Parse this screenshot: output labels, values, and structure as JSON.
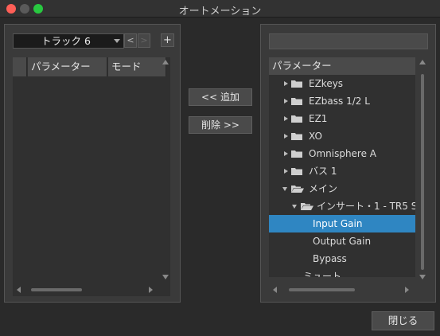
{
  "window": {
    "title": "オートメーション"
  },
  "left": {
    "track_selector": "トラック 6",
    "prev": "<",
    "next": ">",
    "add": "+",
    "columns": [
      "",
      "パラメーター",
      "モード"
    ]
  },
  "middle": {
    "add_label": "<< 追加",
    "remove_label": "削除 >>"
  },
  "right": {
    "search_value": "",
    "tree_header": "パラメーター",
    "tree": [
      {
        "label": "EZkeys",
        "expanded": false,
        "folder": true
      },
      {
        "label": "EZbass 1/2 L",
        "expanded": false,
        "folder": true
      },
      {
        "label": "EZ1",
        "expanded": false,
        "folder": true
      },
      {
        "label": "XO",
        "expanded": false,
        "folder": true
      },
      {
        "label": "Omnisphere A",
        "expanded": false,
        "folder": true
      },
      {
        "label": "バス 1",
        "expanded": false,
        "folder": true
      },
      {
        "label": "メイン",
        "expanded": true,
        "folder": true
      },
      {
        "label": "インサート・1 - TR5 S",
        "expanded": true,
        "folder": true
      },
      {
        "label": "Input Gain",
        "selected": true
      },
      {
        "label": "Output Gain"
      },
      {
        "label": "Bypass"
      },
      {
        "label": "ミュート"
      }
    ]
  },
  "footer": {
    "close_label": "閉じる"
  },
  "colors": {
    "selection": "#2f86c2",
    "background": "#2a2a2a"
  }
}
